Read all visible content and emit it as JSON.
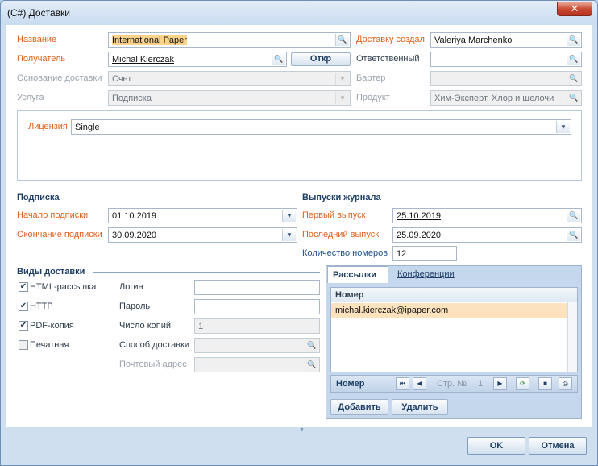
{
  "window": {
    "title": "(C#) Доставки",
    "close_glyph": "✕"
  },
  "top": {
    "name_label": "Название",
    "name_value": "International Paper",
    "recipient_label": "Получатель",
    "recipient_value": "Michal Kierczak",
    "open_button": "Откр",
    "basis_label": "Основание доставки",
    "basis_value": "Счет",
    "service_label": "Услуга",
    "service_value": "Подписка",
    "created_by_label": "Доставку создал",
    "created_by_value": "Valeriya Marchenko",
    "responsible_label": "Ответственный",
    "responsible_value": "",
    "barter_label": "Бартер",
    "barter_value": "",
    "product_label": "Продукт",
    "product_value": "Хим-Эксперт. Хлор и щелочи"
  },
  "license": {
    "label": "Лицензия",
    "value": "Single"
  },
  "subscription": {
    "title": "Подписка",
    "start_label": "Начало подписки",
    "start_value": "01.10.2019",
    "end_label": "Окончание подписки",
    "end_value": "30.09.2020"
  },
  "issues": {
    "title": "Выпуски журнала",
    "first_label": "Первый выпуск",
    "first_value": "25.10.2019",
    "last_label": "Последний выпуск",
    "last_value": "25.09.2020",
    "count_label": "Количество номеров",
    "count_value": "12"
  },
  "delivery_types": {
    "title": "Виды доставки",
    "items": [
      {
        "label": "HTML-рассылка",
        "checked": true
      },
      {
        "label": "HTTP",
        "checked": true
      },
      {
        "label": "PDF-копия",
        "checked": true
      },
      {
        "label": "Печатная",
        "checked": false
      }
    ],
    "login_label": "Логин",
    "login_value": "",
    "password_label": "Пароль",
    "password_value": "",
    "copies_label": "Число копий",
    "copies_value": "1",
    "method_label": "Способ доставки",
    "method_value": "",
    "postal_label": "Почтовый адрес",
    "postal_value": ""
  },
  "tabs": {
    "tab_mailings": "Рассылки",
    "tab_conferences": "Конференции",
    "grid_header": "Номер",
    "rows": [
      "michal.kierczak@ipaper.com"
    ],
    "pager_label": "Номер",
    "page_label": "Стр. №",
    "page_number": "1",
    "add_button": "Добавить",
    "delete_button": "Удалить"
  },
  "footer": {
    "ok": "OK",
    "cancel": "Отмена"
  },
  "colors": {
    "required_label": "#e0601c",
    "selection": "#fde3bd",
    "accent": "#1f3f66"
  }
}
